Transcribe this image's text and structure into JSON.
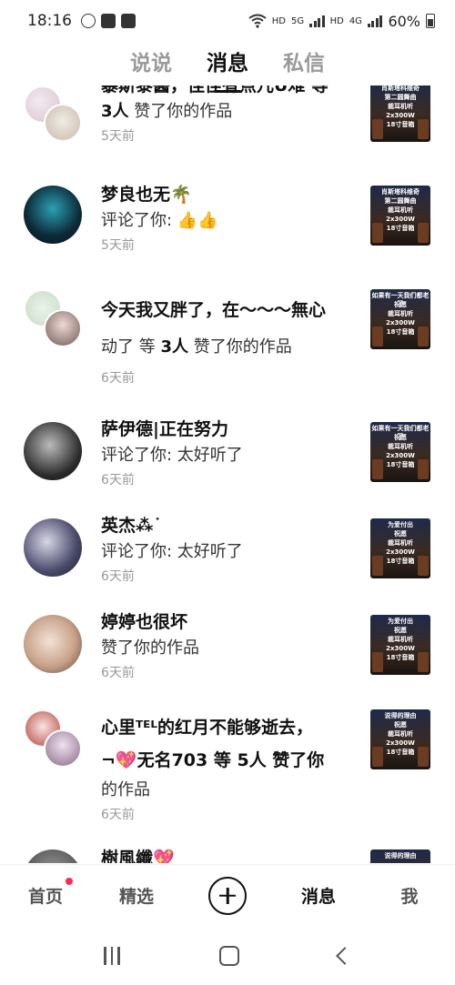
{
  "status_bar": {
    "time": "18:16",
    "network_labels": [
      "HD",
      "5G",
      "HD",
      "4G"
    ],
    "battery": "60%"
  },
  "top_tabs": [
    {
      "label": "说说",
      "active": false
    },
    {
      "label": "消息",
      "active": true
    },
    {
      "label": "私信",
      "active": false
    }
  ],
  "messages": [
    {
      "name": "暴斯黎醬，佳佳有点儿U难 等",
      "action_prefix": "",
      "action_bold": "3人",
      "action_suffix": " 赞了你的作品",
      "time": "5天前",
      "thumb_lines": [
        "肖斯塔科维奇",
        "第二圆舞曲",
        "裁耳机听",
        "2x300W",
        "18寸音箱"
      ]
    },
    {
      "name": "梦良也无🌴",
      "action_prefix": "评论了你: 👍👍",
      "action_bold": "",
      "action_suffix": "",
      "time": "5天前",
      "thumb_lines": [
        "肖斯塔科维奇",
        "第二圆舞曲",
        "裁耳机听",
        "2x300W",
        "18寸音箱"
      ]
    },
    {
      "name": "今天我又胖了，在～～～無心",
      "action_prefix": "动了 等 ",
      "action_bold": "3人",
      "action_suffix": " 赞了你的作品",
      "time": "6天前",
      "thumb_lines": [
        "如果有一天我们都老了",
        "祝愿",
        "裁耳机听",
        "2x300W",
        "18寸音箱"
      ]
    },
    {
      "name": "萨伊德|正在努力",
      "action_prefix": "评论了你: 太好听了",
      "action_bold": "",
      "action_suffix": "",
      "time": "6天前",
      "thumb_lines": [
        "如果有一天我们都老了",
        "祝愿",
        "裁耳机听",
        "2x300W",
        "18寸音箱"
      ]
    },
    {
      "name": "英杰⁂˙",
      "action_prefix": "评论了你: 太好听了",
      "action_bold": "",
      "action_suffix": "",
      "time": "6天前",
      "thumb_lines": [
        "为爱付出",
        "祝愿",
        "裁耳机听",
        "2x300W",
        "18寸音箱"
      ]
    },
    {
      "name": "婷婷也很坏",
      "action_prefix": "赞了你的作品",
      "action_bold": "",
      "action_suffix": "",
      "time": "6天前",
      "thumb_lines": [
        "为爱付出",
        "祝愿",
        "裁耳机听",
        "2x300W",
        "18寸音箱"
      ]
    },
    {
      "name": "心里ᵀᴱᴸ的红月不能够逝去，",
      "name2": "¬💖无名703 等 5人 赞了你",
      "action_prefix": "的作品",
      "action_bold": "",
      "action_suffix": "",
      "time": "6天前",
      "thumb_lines": [
        "说得的理由",
        "祝愿",
        "裁耳机听",
        "2x300W",
        "18寸音箱"
      ]
    },
    {
      "name": "樹風纖💖",
      "action_prefix": "",
      "action_bold": "",
      "action_suffix": "",
      "time": "",
      "thumb_lines": [
        "说得的理由"
      ]
    }
  ],
  "bottom_nav": [
    {
      "label": "首页",
      "badge": true
    },
    {
      "label": "精选",
      "badge": false
    },
    {
      "label": "",
      "plus": true
    },
    {
      "label": "消息",
      "active": true
    },
    {
      "label": "我",
      "badge": false
    }
  ],
  "colors": {
    "accent_badge": "#ff2a55",
    "muted_text": "#999999",
    "inactive_tab": "#9a9a9a"
  }
}
